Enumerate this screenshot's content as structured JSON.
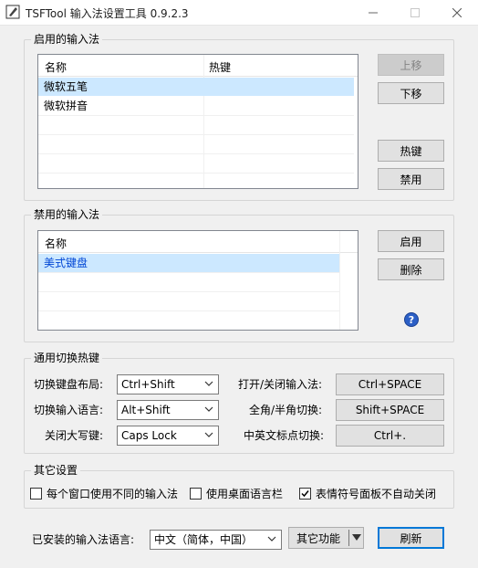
{
  "window": {
    "title": "TSFTool 输入法设置工具 0.9.2.3"
  },
  "enabled_group": {
    "title": "启用的输入法",
    "columns": [
      "名称",
      "热键"
    ],
    "rows": [
      {
        "name": "微软五笔",
        "hotkey": ""
      },
      {
        "name": "微软拼音",
        "hotkey": ""
      }
    ],
    "buttons": {
      "up": "上移",
      "down": "下移",
      "hotkey": "热键",
      "disable": "禁用"
    }
  },
  "disabled_group": {
    "title": "禁用的输入法",
    "columns": [
      "名称"
    ],
    "rows": [
      {
        "name": "美式键盘"
      }
    ],
    "buttons": {
      "enable": "启用",
      "delete": "删除"
    },
    "help_icon": "?"
  },
  "hotkeys_group": {
    "title": "通用切换热键",
    "switch_layout": {
      "label": "切换键盘布局:",
      "value": "Ctrl+Shift"
    },
    "switch_language": {
      "label": "切换输入语言:",
      "value": "Alt+Shift"
    },
    "caps_off": {
      "label": "关闭大写键:",
      "value": "Caps Lock"
    },
    "toggle_ime": {
      "label": "打开/关闭输入法:",
      "value": "Ctrl+SPACE"
    },
    "full_half": {
      "label": "全角/半角切换:",
      "value": "Shift+SPACE"
    },
    "punct": {
      "label": "中英文标点切换:",
      "value": "Ctrl+."
    }
  },
  "other_group": {
    "title": "其它设置",
    "options": [
      {
        "label": "每个窗口使用不同的输入法",
        "checked": false
      },
      {
        "label": "使用桌面语言栏",
        "checked": false
      },
      {
        "label": "表情符号面板不自动关闭",
        "checked": true
      }
    ]
  },
  "footer": {
    "installed_label": "已安装的输入法语言:",
    "language_value": "中文（简体，中国）",
    "other_functions": "其它功能",
    "refresh": "刷新"
  }
}
